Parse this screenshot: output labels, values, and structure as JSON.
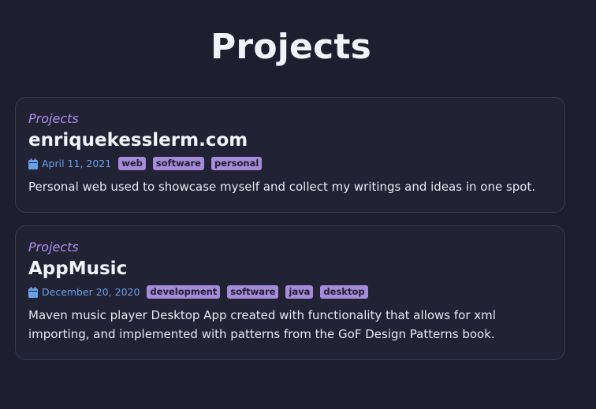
{
  "page": {
    "title": "Projects"
  },
  "posts": [
    {
      "category": "Projects",
      "title": "enriquekesslerm.com",
      "date": "April 11, 2021",
      "tags": [
        "web",
        "software",
        "personal"
      ],
      "description": "Personal web used to showcase myself and collect my writings and ideas in one spot."
    },
    {
      "category": "Projects",
      "title": "AppMusic",
      "date": "December 20, 2020",
      "tags": [
        "development",
        "software",
        "java",
        "desktop"
      ],
      "description": "Maven music player Desktop App created with functionality that allows for xml importing, and implemented with patterns from the GoF Design Patterns book."
    }
  ],
  "colors": {
    "background": "#1e1e2e",
    "card": "#212233",
    "accent": "#b48ef0",
    "tag": "#a78bdb",
    "date": "#6aa0e8"
  },
  "icons": {
    "date": "calendar-icon"
  }
}
